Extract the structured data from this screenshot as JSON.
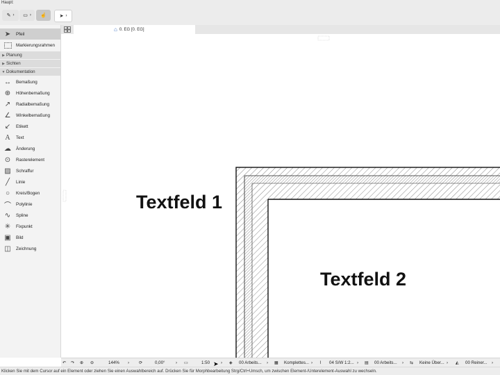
{
  "toolbar": {
    "label": "Haupt:"
  },
  "tab": {
    "title": "0. EG [0. EG]"
  },
  "toolbox": {
    "selected": "Pfeil",
    "top_tools": [
      {
        "label": "Pfeil",
        "icon": "arrow-pointer-icon"
      },
      {
        "label": "Markierungsrahmen",
        "icon": "marquee-icon"
      }
    ],
    "categories": [
      "Planung",
      "Sichten",
      "Dokumentation"
    ],
    "doc_tools": [
      {
        "label": "Bemaßung",
        "icon": "dimension-icon"
      },
      {
        "label": "Höhenbemaßung",
        "icon": "level-dimension-icon"
      },
      {
        "label": "Radialbemaßung",
        "icon": "radial-dimension-icon"
      },
      {
        "label": "Winkelbemaßung",
        "icon": "angle-dimension-icon"
      },
      {
        "label": "Etikett",
        "icon": "label-icon"
      },
      {
        "label": "Text",
        "icon": "text-icon"
      },
      {
        "label": "Änderung",
        "icon": "change-icon"
      },
      {
        "label": "Rasterelement",
        "icon": "grid-element-icon"
      },
      {
        "label": "Schraffur",
        "icon": "fill-icon"
      },
      {
        "label": "Linie",
        "icon": "line-icon"
      },
      {
        "label": "Kreis/Bogen",
        "icon": "circle-icon"
      },
      {
        "label": "Polylinie",
        "icon": "polyline-icon"
      },
      {
        "label": "Spline",
        "icon": "spline-icon"
      },
      {
        "label": "Fixpunkt",
        "icon": "hotspot-icon"
      },
      {
        "label": "Bild",
        "icon": "image-icon"
      },
      {
        "label": "Zeichnung",
        "icon": "drawing-icon"
      }
    ]
  },
  "canvas": {
    "textfeld1": "Textfeld 1",
    "textfeld2": "Textfeld 2"
  },
  "statusbar": {
    "zoom": "144%",
    "angle": "0,00°",
    "scale": "1:50",
    "layer_combo": "00 Arbeits...",
    "structure": "Komplettes...",
    "pen_set": "04 S/W 1:2...",
    "model_view": "00 Arbeits...",
    "override": "Keine Über...",
    "renovation": "00 Reiner..."
  },
  "hint": "Klicken Sie mit dem Cursor auf ein Element oder ziehen Sie einen Auswahlbereich auf. Drücken Sie für Morphbearbeitung Strg/Ctrl+Umsch, um zwischen Element-/Unterelement-Auswahl zu wechseln."
}
